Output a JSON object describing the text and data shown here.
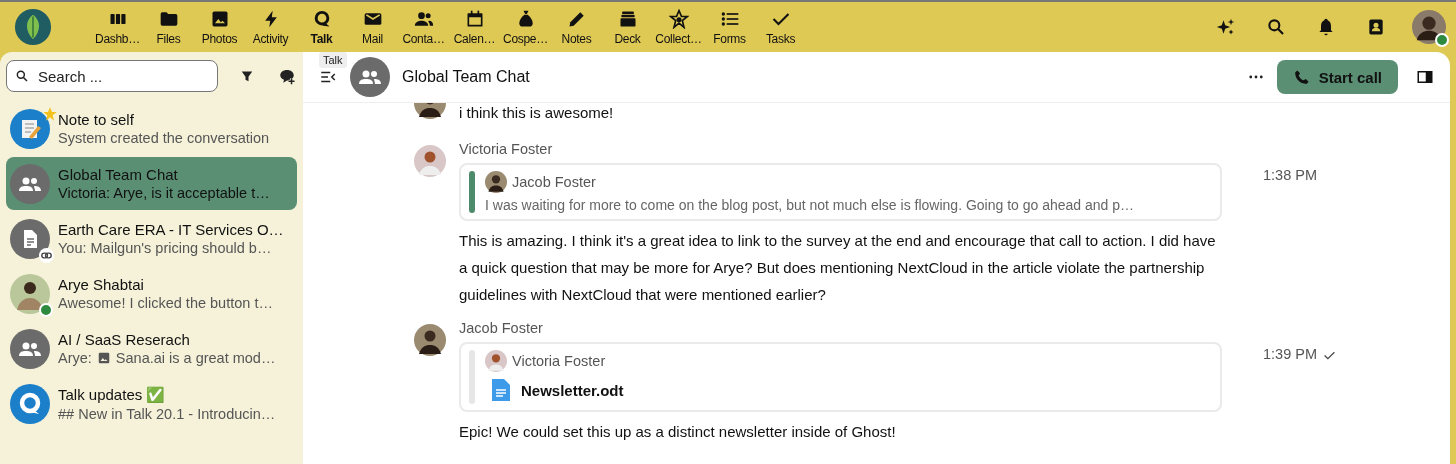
{
  "top_bar": {
    "apps": [
      {
        "label": "Dashb…",
        "selected": false
      },
      {
        "label": "Files",
        "selected": false
      },
      {
        "label": "Photos",
        "selected": false
      },
      {
        "label": "Activity",
        "selected": false
      },
      {
        "label": "Talk",
        "selected": true
      },
      {
        "label": "Mail",
        "selected": false
      },
      {
        "label": "Conta…",
        "selected": false
      },
      {
        "label": "Calen…",
        "selected": false
      },
      {
        "label": "Cospe…",
        "selected": false
      },
      {
        "label": "Notes",
        "selected": false
      },
      {
        "label": "Deck",
        "selected": false
      },
      {
        "label": "Collect…",
        "selected": false
      },
      {
        "label": "Forms",
        "selected": false
      },
      {
        "label": "Tasks",
        "selected": false
      }
    ],
    "user_online": true
  },
  "tooltip": "Talk",
  "sidebar": {
    "search": {
      "placeholder": "Search ..."
    },
    "conversations": [
      {
        "kind": "note",
        "name": "Note to self",
        "preview": "System created the conversation",
        "selected": false,
        "favorite": true,
        "online": false,
        "shared_link": false
      },
      {
        "kind": "group",
        "name": "Global Team Chat",
        "preview": "Victoria: Arye, is it acceptable t…",
        "selected": true,
        "favorite": false,
        "online": false,
        "shared_link": false
      },
      {
        "kind": "document",
        "name": "Earth Care ERA - IT Services O…",
        "preview": "You: Mailgun's pricing should b…",
        "selected": false,
        "favorite": false,
        "online": false,
        "shared_link": true
      },
      {
        "kind": "person",
        "name": "Arye Shabtai",
        "preview": "Awesome! I clicked the button t…",
        "selected": false,
        "favorite": false,
        "online": true,
        "shared_link": false
      },
      {
        "kind": "group",
        "name": "AI / SaaS Reserach",
        "preview_sender": "Arye:",
        "preview": "Sana.ai is a great mod…",
        "image_attachment": true,
        "selected": false,
        "favorite": false,
        "online": false,
        "shared_link": false
      },
      {
        "kind": "app",
        "name": "Talk updates ✅",
        "preview": "## New in Talk 20.1 - Introducin…",
        "selected": false,
        "favorite": false,
        "online": false,
        "shared_link": false
      }
    ]
  },
  "chat": {
    "title": "Global Team Chat",
    "start_call": "Start call",
    "messages": [
      {
        "text": "i think this is awesome!"
      },
      {
        "author": "Victoria Foster",
        "time": "1:38 PM",
        "delivered": false,
        "quote": {
          "author": "Jacob Foster",
          "text": "I was waiting for more to come on the blog post, but not much else is flowing. Going to go ahead and p…",
          "color": "#4e8a6c"
        },
        "text": "This is amazing. I think it's a great idea to link to the survey at the end and encourage that call to action. I did have a quick question that may be more for Arye? But does mentioning NextCloud in the article violate the partnership guidelines with NextCloud that were mentioned earlier?"
      },
      {
        "author": "Jacob Foster",
        "time": "1:39 PM",
        "delivered": true,
        "quote": {
          "author": "Victoria Foster",
          "file": "Newsletter.odt",
          "color": "#e6e6e6"
        },
        "text": "Epic! We could set this up as a distinct newsletter inside of Ghost!"
      }
    ]
  }
}
